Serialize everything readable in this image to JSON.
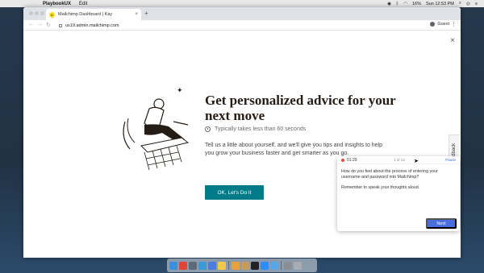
{
  "menubar": {
    "app_name": "PlaybookUX",
    "menu_edit": "Edit",
    "battery": "16%",
    "clock": "Sun 12:53 PM"
  },
  "browser": {
    "tab_title": "Mailchimp Dashboard | Kay",
    "tab_favicon": "C",
    "new_tab": "+",
    "url": "us19.admin.mailchimp.com",
    "profile": "Guest"
  },
  "page": {
    "headline": "Get personalized advice for your next move",
    "time_estimate": "Typically takes less than 60 seconds",
    "description": "Tell us a little about yourself, and we'll give you tips and insights to help you grow your business faster and get smarter as you go.",
    "cta_label": "OK, Let's Do It",
    "feedback_label": "Feedback",
    "close_glyph": "×"
  },
  "task_widget": {
    "timer": "01:29",
    "progress": "1 of 13",
    "pause_label": "Pause",
    "question": "How do you feel about the process of entering your username and password into Mailchimp?",
    "hint": "Remember to speak your thoughts aloud.",
    "next_label": "Next"
  },
  "dock": {
    "items": [
      "finder-icon",
      "chrome-icon",
      "gmail-icon",
      "safari-icon",
      "appstore-icon",
      "notes-icon",
      "photos-icon",
      "contacts-icon",
      "notion-icon",
      "zoom-icon",
      "lightbulb-icon",
      "uxapp-icon",
      "preview-icon",
      "trash-icon"
    ]
  },
  "colors": {
    "cta": "#007c89",
    "next": "#4a6ee0",
    "headline": "#241c15"
  }
}
